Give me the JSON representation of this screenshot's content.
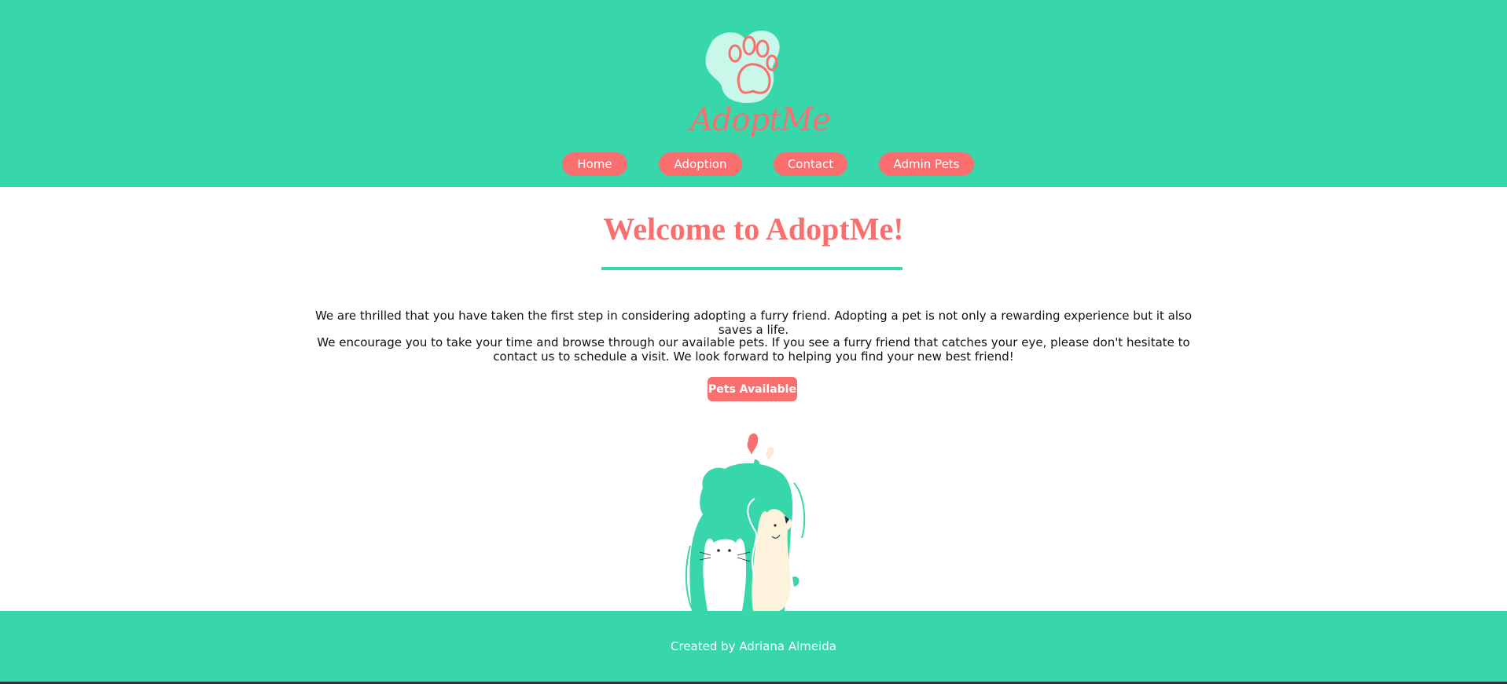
{
  "brand": {
    "name": "AdoptMe"
  },
  "nav": {
    "items": [
      {
        "label": "Home"
      },
      {
        "label": "Adoption"
      },
      {
        "label": "Contact"
      },
      {
        "label": "Admin Pets"
      }
    ]
  },
  "main": {
    "title": "Welcome to AdoptMe!",
    "paragraph1": "We are thrilled that you have taken the first step in considering adopting a furry friend. Adopting a pet is not only a rewarding experience but it also saves a life.",
    "paragraph2": "We encourage you to take your time and browse through our available pets. If you see a furry friend that catches your eye, please don't hesitate to contact us to schedule a visit. We look forward to helping you find your new best friend!",
    "cta_label": "Pets Available"
  },
  "footer": {
    "text": "Created by Adriana Almeida"
  },
  "colors": {
    "primary": "#37d6ab",
    "accent": "#f96f6f",
    "cream": "#fdf3dc"
  },
  "icons": {
    "logo": "paw-icon",
    "illustration": "cat-and-dog-illustration"
  }
}
